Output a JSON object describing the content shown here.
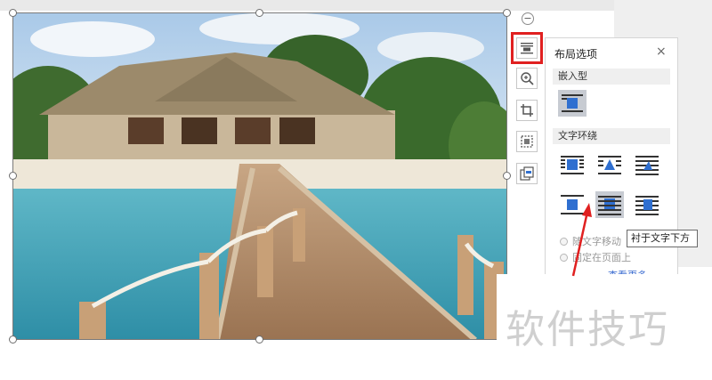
{
  "panel": {
    "title": "布局选项",
    "close_glyph": "×",
    "section_inline": "嵌入型",
    "section_wrap": "文字环绕",
    "option_move": "随文字移动",
    "option_fix": "固定在页面上",
    "more_link": "查看更多"
  },
  "tooltip": {
    "text": "衬于文字下方"
  },
  "rotate_glyph": "−",
  "toolbar_icons": [
    "layout-options-icon",
    "zoom-in-icon",
    "crop-icon",
    "picture-effects-icon",
    "picture-convert-icon"
  ],
  "wrap_options": [
    "square-wrap",
    "tight-wrap",
    "through-wrap",
    "top-bottom-wrap",
    "behind-text-wrap",
    "in-front-of-text-wrap"
  ],
  "watermark": {
    "text": "软件技巧"
  },
  "colors": {
    "highlight_red": "#e02020",
    "arrow_red": "#e02020",
    "icon_blue": "#2f6fd0",
    "selected_bg": "#c7cbd2"
  }
}
